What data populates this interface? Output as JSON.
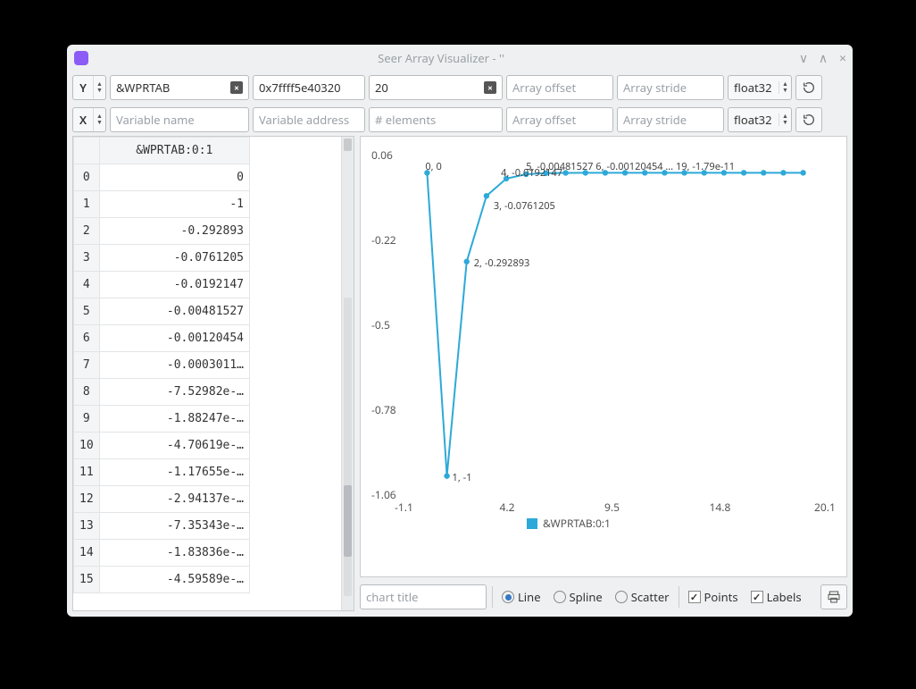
{
  "window_title": "Seer Array Visualizer - ''",
  "rows": {
    "y": {
      "axis": "Y",
      "var_name": "&WPRTAB",
      "var_name_placeholder": "Variable name",
      "var_addr": "0x7ffff5e40320",
      "var_addr_placeholder": "Variable address",
      "n_elements": "20",
      "n_elements_placeholder": "# elements",
      "offset": "",
      "offset_placeholder": "Array offset",
      "stride": "",
      "stride_placeholder": "Array stride",
      "dtype": "float32"
    },
    "x": {
      "axis": "X",
      "var_name": "",
      "var_name_placeholder": "Variable name",
      "var_addr": "",
      "var_addr_placeholder": "Variable address",
      "n_elements": "",
      "n_elements_placeholder": "# elements",
      "offset": "",
      "offset_placeholder": "Array offset",
      "stride": "",
      "stride_placeholder": "Array stride",
      "dtype": "float32"
    }
  },
  "table": {
    "header": "&WPRTAB:0:1",
    "rows": [
      {
        "i": "0",
        "v": "0"
      },
      {
        "i": "1",
        "v": "-1"
      },
      {
        "i": "2",
        "v": "-0.292893"
      },
      {
        "i": "3",
        "v": "-0.0761205"
      },
      {
        "i": "4",
        "v": "-0.0192147"
      },
      {
        "i": "5",
        "v": "-0.00481527"
      },
      {
        "i": "6",
        "v": "-0.00120454"
      },
      {
        "i": "7",
        "v": "-0.0003011…"
      },
      {
        "i": "8",
        "v": "-7.52982e-…"
      },
      {
        "i": "9",
        "v": "-1.88247e-…"
      },
      {
        "i": "10",
        "v": "-4.70619e-…"
      },
      {
        "i": "11",
        "v": "-1.17655e-…"
      },
      {
        "i": "12",
        "v": "-2.94137e-…"
      },
      {
        "i": "13",
        "v": "-7.35343e-…"
      },
      {
        "i": "14",
        "v": "-1.83836e-…"
      },
      {
        "i": "15",
        "v": "-4.59589e-…"
      }
    ]
  },
  "chart_title_placeholder": "chart title",
  "plot_modes": {
    "line": "Line",
    "spline": "Spline",
    "scatter": "Scatter"
  },
  "toggles": {
    "points": "Points",
    "labels": "Labels"
  },
  "chart_data": {
    "type": "line",
    "title": "",
    "series_name": "&WPRTAB:0:1",
    "x": [
      0,
      1,
      2,
      3,
      4,
      5,
      6,
      7,
      8,
      9,
      10,
      11,
      12,
      13,
      14,
      15,
      16,
      17,
      18,
      19
    ],
    "y": [
      0,
      -1,
      -0.292893,
      -0.0761205,
      -0.0192147,
      -0.00481527,
      -0.00120454,
      -0.000301,
      -7.53e-05,
      -1.88e-05,
      -4.71e-06,
      -1.18e-06,
      -2.94e-07,
      -7.35e-08,
      -1.84e-08,
      -4.6e-09,
      -1.15e-09,
      -2.87e-10,
      -7.19e-11,
      -1.8e-11
    ],
    "xlim": [
      -1.1,
      20.1
    ],
    "ylim": [
      -1.06,
      0.06
    ],
    "xticks": [
      -1.1,
      4.2,
      9.5,
      14.8,
      20.1
    ],
    "yticks": [
      0.06,
      -0.22,
      -0.5,
      -0.78,
      -1.06
    ],
    "point_labels": [
      "0, 0",
      "1, -1",
      "2, -0.292893",
      "3, -0.0761205",
      "4, -0.0192147"
    ]
  },
  "legend_label": "&WPRTAB:0:1"
}
